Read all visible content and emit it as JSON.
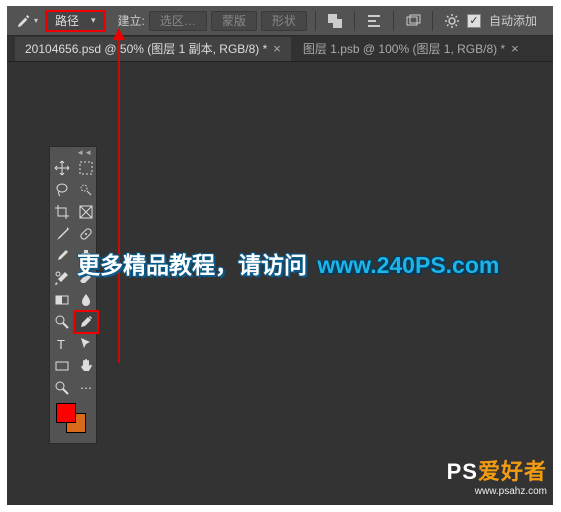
{
  "optionsBar": {
    "modeDropdown": "路径",
    "buildLabel": "建立:",
    "btnSelection": "选区…",
    "btnMask": "蒙版",
    "btnShape": "形状",
    "autoAddLabel": "自动添加"
  },
  "tabs": [
    {
      "label": "20104656.psd @ 50% (图层 1 副本, RGB/8) *"
    },
    {
      "label": "图层 1.psb @ 100% (图层 1, RGB/8) *"
    }
  ],
  "swatches": {
    "fg": "#ff0000",
    "bg": "#d86a1a"
  },
  "overlay": {
    "part1": "更多精品教程，请访问",
    "part2": "www.240PS.com"
  },
  "watermark": {
    "logo1": "PS",
    "logo2": "爱好者",
    "url": "www.psahz.com"
  },
  "annotations": {
    "highlightDropdown": true,
    "highlightPenTool": true
  }
}
